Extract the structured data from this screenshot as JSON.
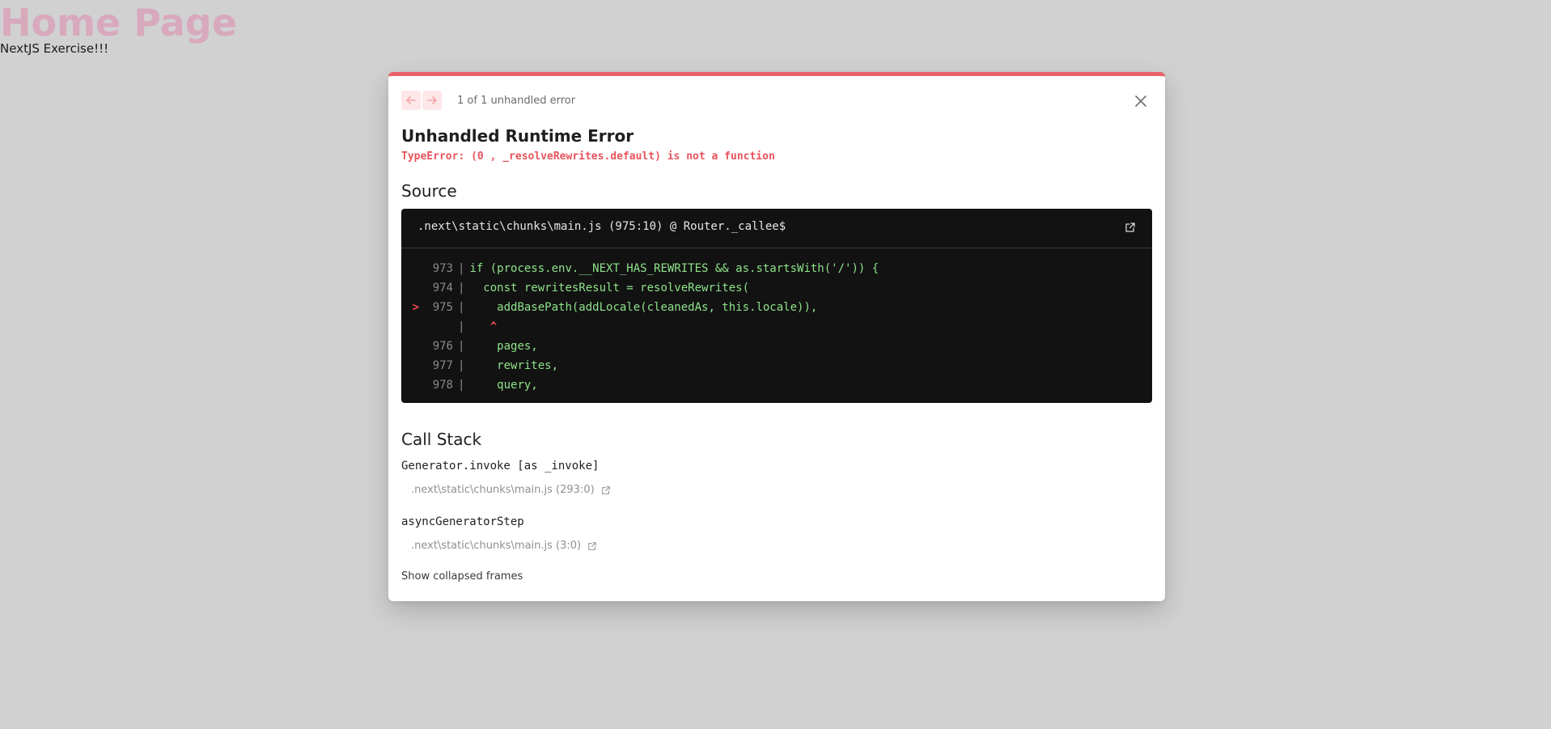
{
  "page": {
    "heading": "Home Page",
    "subtitle": "NextJS Exercise!!!"
  },
  "overlay": {
    "error_count": "1 of 1 unhandled error",
    "title": "Unhandled Runtime Error",
    "message": "TypeError: (0 , _resolveRewrites.default) is not a function",
    "source_heading": "Source",
    "source_file": ".next\\static\\chunks\\main.js (975:10) @ Router._callee$",
    "code_lines": [
      {
        "marker": "",
        "number": "973",
        "gutter": "|",
        "code": "if (process.env.__NEXT_HAS_REWRITES && as.startsWith('/')) {"
      },
      {
        "marker": "",
        "number": "974",
        "gutter": "|",
        "code": "  const rewritesResult = resolveRewrites("
      },
      {
        "marker": ">",
        "number": "975",
        "gutter": "|",
        "code": "    addBasePath(addLocale(cleanedAs, this.locale)),"
      },
      {
        "marker": "",
        "number": "",
        "gutter": "|",
        "code": "   ^"
      },
      {
        "marker": "",
        "number": "976",
        "gutter": "|",
        "code": "    pages,"
      },
      {
        "marker": "",
        "number": "977",
        "gutter": "|",
        "code": "    rewrites,"
      },
      {
        "marker": "",
        "number": "978",
        "gutter": "|",
        "code": "    query,"
      }
    ],
    "call_stack_heading": "Call Stack",
    "frames": [
      {
        "function": "Generator.invoke [as _invoke]",
        "location": ".next\\static\\chunks\\main.js (293:0)"
      },
      {
        "function": "asyncGeneratorStep",
        "location": ".next\\static\\chunks\\main.js (3:0)"
      }
    ],
    "show_collapsed_label": "Show collapsed frames"
  },
  "icons": {
    "prev": "arrow-left-icon",
    "next": "arrow-right-icon",
    "close": "close-icon",
    "external": "external-link-icon"
  },
  "colors": {
    "accent": "#e8626a",
    "error_text": "#e8535c",
    "code_bg": "#121212",
    "code_text": "#8ee38a",
    "heading_pink": "#d8a9bd",
    "backdrop": "#d1d1d1"
  }
}
